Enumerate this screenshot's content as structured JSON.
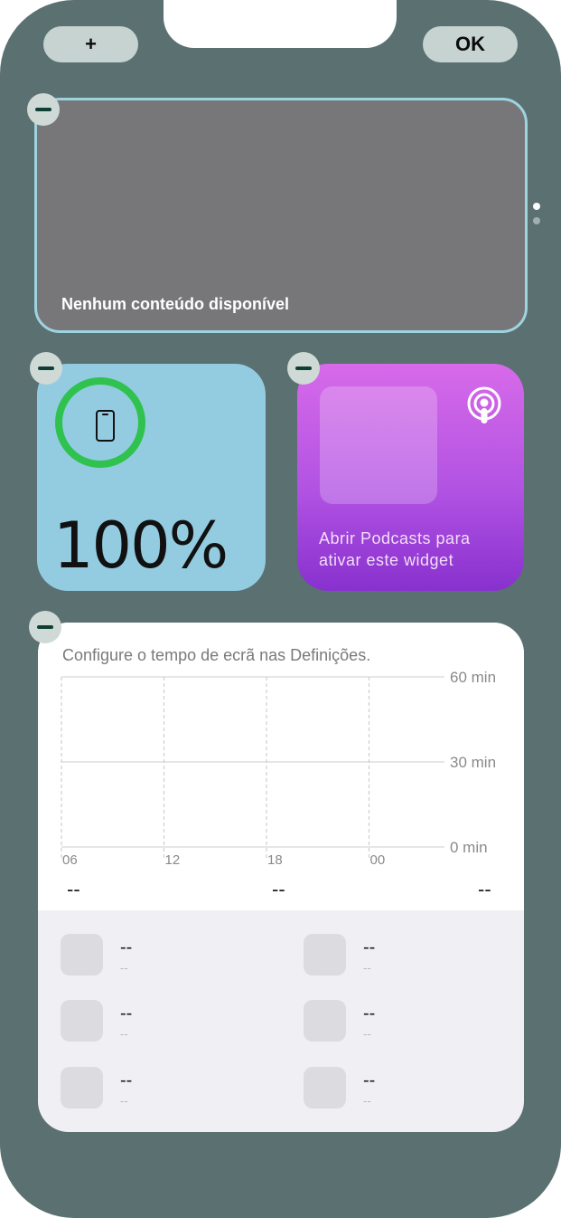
{
  "toolbar": {
    "add_label": "+",
    "done_label": "OK"
  },
  "widgets": {
    "empty": {
      "message": "Nenhum conteúdo disponível"
    },
    "battery": {
      "percentage": "100%"
    },
    "podcasts": {
      "message": "Abrir Podcasts para ativar este widget"
    },
    "screen_time": {
      "message": "Configure o tempo de ecrã nas Definições.",
      "summary": [
        "--",
        "--",
        "--"
      ],
      "apps": [
        {
          "name": "--",
          "time": "--"
        },
        {
          "name": "--",
          "time": "--"
        },
        {
          "name": "--",
          "time": "--"
        },
        {
          "name": "--",
          "time": "--"
        },
        {
          "name": "--",
          "time": "--"
        },
        {
          "name": "--",
          "time": "--"
        }
      ]
    }
  },
  "page_indicator": {
    "pages": 2,
    "current": 1
  },
  "colors": {
    "background": "#5a7071",
    "battery_ring": "#2fc24f",
    "battery_widget": "#93cce0",
    "podcast_top": "#d76ae9",
    "podcast_bottom": "#8831ce"
  },
  "chart_data": {
    "type": "bar",
    "categories": [
      "06",
      "12",
      "18",
      "00"
    ],
    "x_tick_labels": [
      "06",
      "12",
      "18",
      "00"
    ],
    "y_tick_labels": [
      "0 min",
      "30 min",
      "60 min"
    ],
    "ylim": [
      0,
      60
    ],
    "grid": true,
    "series": []
  }
}
